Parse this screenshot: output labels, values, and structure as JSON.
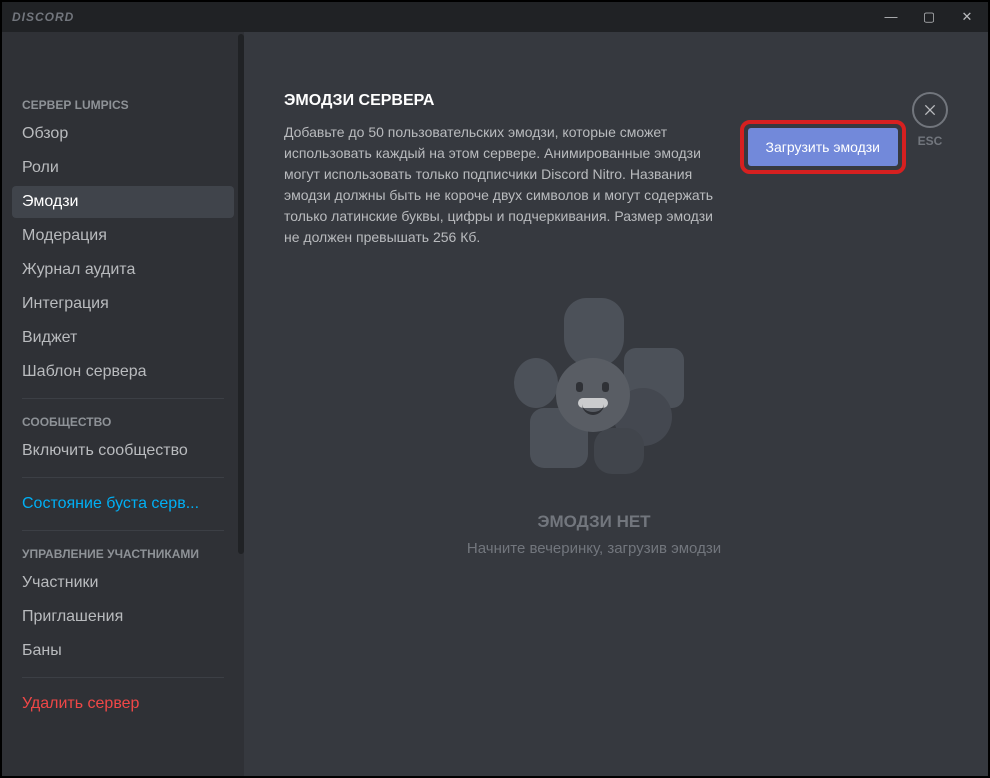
{
  "titlebar": {
    "logo": "DISCORD"
  },
  "sidebar": {
    "section1_header": "СЕРВЕР LUMPICS",
    "items1": [
      {
        "label": "Обзор"
      },
      {
        "label": "Роли"
      },
      {
        "label": "Эмодзи",
        "active": true
      },
      {
        "label": "Модерация"
      },
      {
        "label": "Журнал аудита"
      },
      {
        "label": "Интеграция"
      },
      {
        "label": "Виджет"
      },
      {
        "label": "Шаблон сервера"
      }
    ],
    "section2_header": "СООБЩЕСТВО",
    "items2": [
      {
        "label": "Включить сообщество"
      }
    ],
    "boost_link": "Состояние буста серв...",
    "section3_header": "УПРАВЛЕНИЕ УЧАСТНИКАМИ",
    "items3": [
      {
        "label": "Участники"
      },
      {
        "label": "Приглашения"
      },
      {
        "label": "Баны"
      }
    ],
    "delete_label": "Удалить сервер"
  },
  "content": {
    "title": "ЭМОДЗИ СЕРВЕРА",
    "description": "Добавьте до 50 пользовательских эмодзи, которые сможет использовать каждый на этом сервере. Анимированные эмодзи могут использовать только подписчики Discord Nitro. Названия эмодзи должны быть не короче двух символов и могут содержать только латинские буквы, цифры и подчеркивания. Размер эмодзи не должен превышать 256 Кб.",
    "upload_button": "Загрузить эмодзи",
    "empty_title": "ЭМОДЗИ НЕТ",
    "empty_subtitle": "Начните вечеринку, загрузив эмодзи"
  },
  "close": {
    "esc": "ESC"
  },
  "colors": {
    "accent": "#7289da",
    "highlight_border": "#d62020"
  }
}
